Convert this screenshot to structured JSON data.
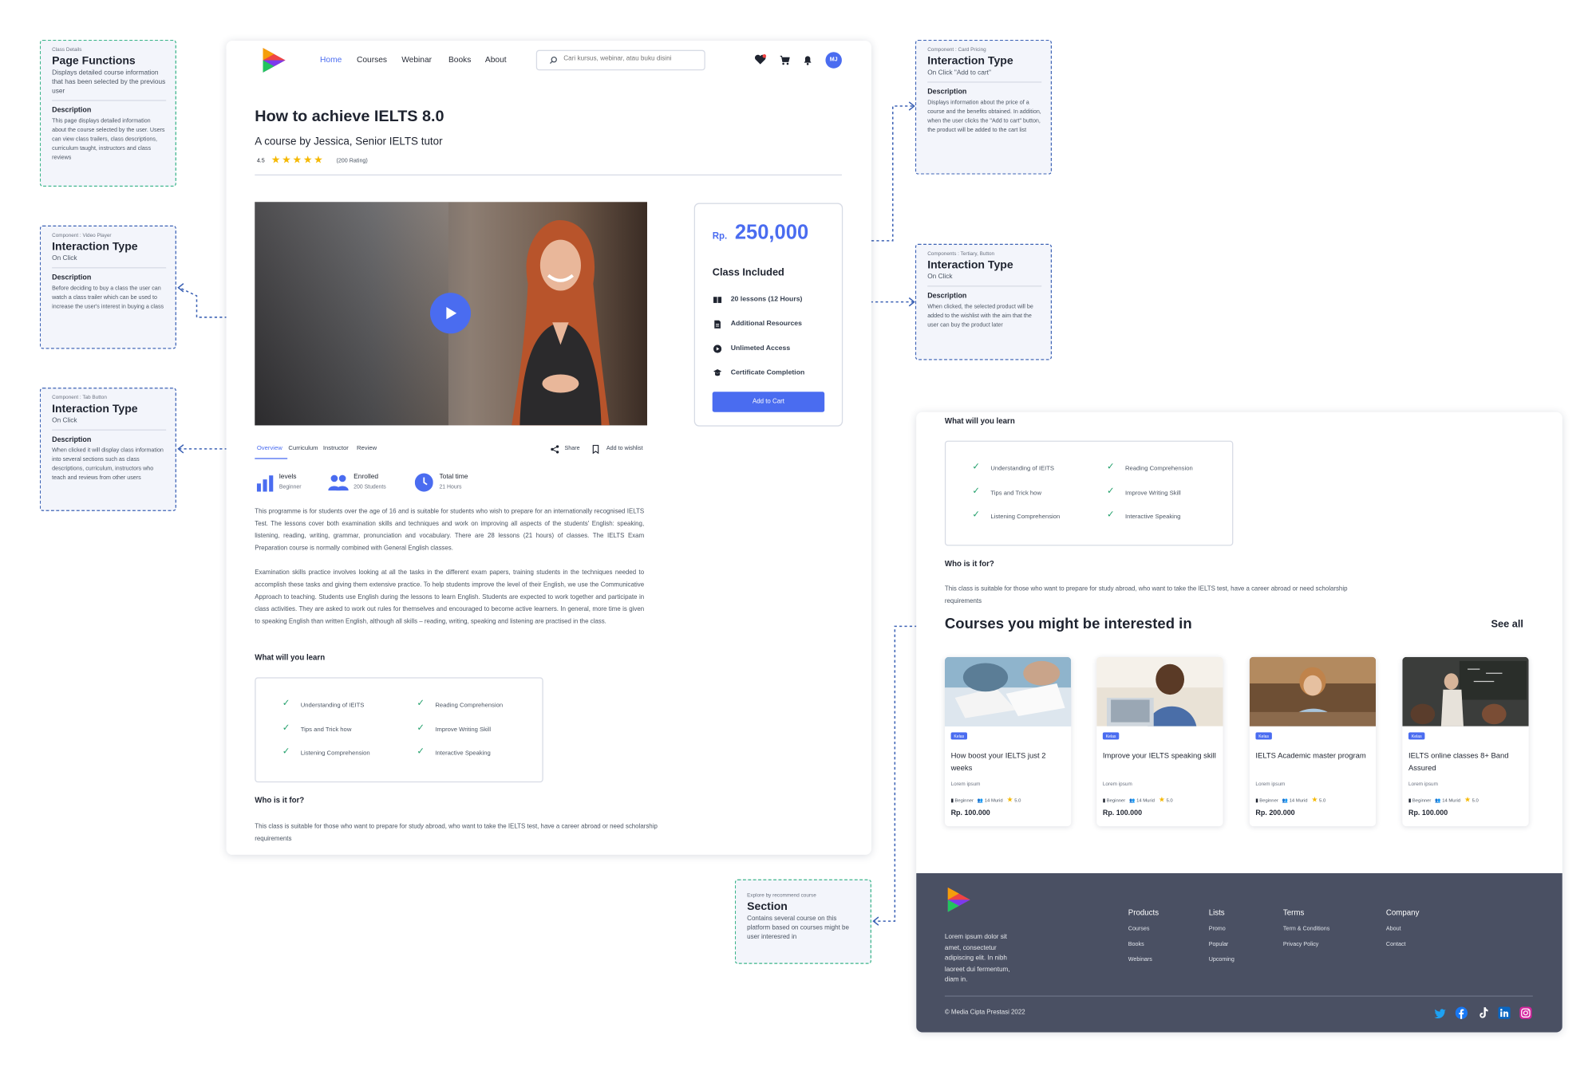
{
  "notes": {
    "page_functions": {
      "sup": "Class Details",
      "title": "Page Functions",
      "subtitle": "Displays detailed course information that has been selected by the previous user",
      "desc_head": "Description",
      "desc": "This page displays detailed information about the course selected by the user. Users can view class trailers, class descriptions, curriculum taught, instructors and class reviews"
    },
    "video_player": {
      "sup": "Component : Video Player",
      "title": "Interaction Type",
      "subtitle": "On Click",
      "desc_head": "Description",
      "desc": "Before deciding to buy a class the user can watch a class trailer which can be used to increase the user's interest in buying a class"
    },
    "tab_button": {
      "sup": "Component : Tab Button",
      "title": "Interaction Type",
      "subtitle": "On Click",
      "desc_head": "Description",
      "desc": "When clicked it will display class information into several sections such as class descriptions, curriculum, instructors who teach and reviews from other users"
    },
    "card_pricing": {
      "sup": "Component : Card Pricing",
      "title": "Interaction Type",
      "subtitle": "On Click \"Add to cart\"",
      "desc_head": "Description",
      "desc": "Displays information about the price of a course and the benefits obtained. In addition, when the user clicks the \"Add to cart\" button, the product will be added to the cart list"
    },
    "tertiary_button": {
      "sup": "Components : Tertiary, Button",
      "title": "Interaction Type",
      "subtitle": "On Click",
      "desc_head": "Description",
      "desc": "When clicked, the selected product will be added to the wishlist with the aim that the user can buy the product later"
    },
    "section": {
      "sup": "Explore by recommend course",
      "title": "Section",
      "subtitle": "Contains several course on this platform based on courses might be user interesred in"
    }
  },
  "nav": {
    "links": [
      "Home",
      "Courses",
      "Webinar",
      "Books",
      "About"
    ],
    "active": "Home",
    "search_placeholder": "Cari kursus, webinar, atau buku disini",
    "avatar": "MJ"
  },
  "course": {
    "title": "How to achieve IELTS 8.0",
    "subtitle": "A course by Jessica, Senior IELTS tutor",
    "rating": "4.5",
    "stars": 5,
    "rating_count": "(200 Rating)"
  },
  "tabs": [
    "Overview",
    "Curriculum",
    "Instructor",
    "Review"
  ],
  "actions": {
    "share": "Share",
    "wishlist": "Add to wishlist"
  },
  "stats": [
    {
      "label": "levels",
      "value": "Beginner"
    },
    {
      "label": "Enrolled",
      "value": "200 Students"
    },
    {
      "label": "Total time",
      "value": "21 Hours"
    }
  ],
  "description": [
    "This programme is for students over the age of 16 and is suitable for students who wish to prepare for an internationally recognised IELTS Test. The lessons cover both examination skills and techniques and work on improving all aspects of the students' English: speaking, listening, reading, writing, grammar, pronunciation and vocabulary. There are 28 lessons (21 hours) of classes. The IELTS Exam Preparation course is normally combined with General English classes.",
    "Examination skills practice involves looking at all the tasks in the different exam papers, training students in the techniques needed to accomplish these tasks and giving them extensive practice. To help students improve the level of their English, we use the Communicative Approach to teaching. Students use English during the lessons to learn English. Students are expected to work together and participate in class activities. They are asked to work out rules for themselves and encouraged to become active learners. In general, more time is given to speaking English than written English, although all skills – reading, writing, speaking and listening are practised in the class."
  ],
  "learn": {
    "heading": "What will you learn",
    "items": [
      "Understanding of IEITS",
      "Reading Comprehension",
      "Tips and Trick how",
      "Improve Writing Skill",
      "Listening Comprehension",
      "Interactive Speaking"
    ]
  },
  "who": {
    "heading": "Who is it for?",
    "text": "This class is suitable for those who want to prepare for study abroad, who want to take the IELTS test, have a career abroad or need scholarship requirements"
  },
  "pricing": {
    "currency": "Rp.",
    "price": "250,000",
    "included_heading": "Class Included",
    "items": [
      "20 lessons (12 Hours)",
      "Additional Resources",
      "Unlimeted Access",
      "Certificate Completion"
    ],
    "button": "Add to Cart"
  },
  "recommend": {
    "heading": "Courses you might be interested in",
    "see_all": "See all",
    "cards": [
      {
        "badge": "Kelas",
        "title": "How boost your IELTS just 2 weeks",
        "desc": "Lorem ipsum",
        "level": "Beginner",
        "students": "14 Murid",
        "rating": "5.0",
        "price": "Rp. 100.000"
      },
      {
        "badge": "Kelas",
        "title": "Improve your IELTS speaking skill",
        "desc": "Lorem ipsum",
        "level": "Beginner",
        "students": "14 Murid",
        "rating": "5.0",
        "price": "Rp. 100.000"
      },
      {
        "badge": "Kelas",
        "title": "IELTS Academic master program",
        "desc": "Lorem ipsum",
        "level": "Beginner",
        "students": "14 Murid",
        "rating": "5.0",
        "price": "Rp. 200.000"
      },
      {
        "badge": "Kelas",
        "title": "IELTS online classes 8+ Band Assured",
        "desc": "Lorem ipsum",
        "level": "Beginner",
        "students": "14 Murid",
        "rating": "5.0",
        "price": "Rp. 100.000"
      }
    ]
  },
  "footer": {
    "about": "Lorem ipsum dolor sit amet, consectetur adipiscing elit. In nibh laoreet dui fermentum, diam in.",
    "columns": [
      {
        "heading": "Products",
        "links": [
          "Courses",
          "Books",
          "Webinars"
        ]
      },
      {
        "heading": "Lists",
        "links": [
          "Promo",
          "Popular",
          "Upcoming"
        ]
      },
      {
        "heading": "Terms",
        "links": [
          "Term & Conditions",
          "Privacy Policy"
        ]
      },
      {
        "heading": "Company",
        "links": [
          "About",
          "Contact"
        ]
      }
    ],
    "copyright": "© Media Cipta Prestasi 2022",
    "social": [
      "twitter-icon",
      "facebook-icon",
      "tiktok-icon",
      "linkedin-icon",
      "instagram-icon"
    ]
  },
  "colors": {
    "primary": "#4a6cf0",
    "accent_blue": "#3c62b5",
    "annotation_green": "#3bb58a",
    "footer_bg": "#4a5063",
    "check": "#22a06b",
    "star": "#f5b800"
  }
}
